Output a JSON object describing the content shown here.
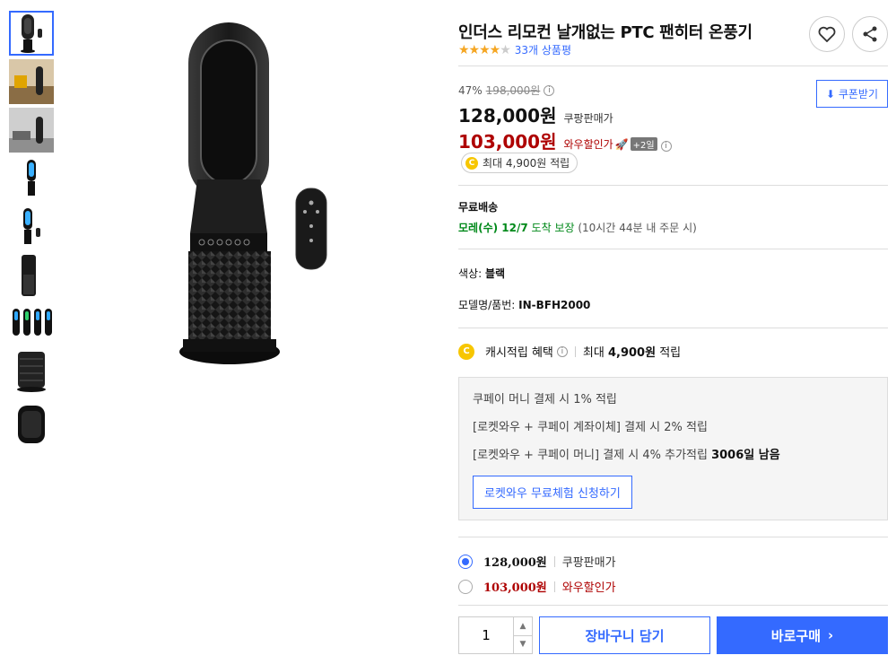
{
  "product": {
    "title": "인더스 리모컨 날개없는 PTC 팬히터 온풍기",
    "rating": 4,
    "review_count_text": "33개 상품평"
  },
  "thumbnails": [
    "thumb-1",
    "thumb-2",
    "thumb-3",
    "thumb-4",
    "thumb-5",
    "thumb-6",
    "thumb-7",
    "thumb-8",
    "thumb-9"
  ],
  "price": {
    "discount_rate": "47%",
    "original_price": "198,000원",
    "sale_price": "128,000원",
    "sale_label": "쿠팡판매가",
    "wow_price": "103,000원",
    "wow_label": "와우할인가",
    "plus_badge": "+2일",
    "coupon_button": "쿠폰받기",
    "cash_pill": "최대 4,900원 적립"
  },
  "shipping": {
    "label": "무료배송",
    "arrive_day": "모레(수) 12/7",
    "arrive_text": "도착 보장",
    "note": "(10시간 44분 내 주문 시)"
  },
  "options": {
    "color_label": "색상:",
    "color_value": "블랙",
    "model_label": "모델명/품번:",
    "model_value": "IN-BFH2000"
  },
  "cash": {
    "label": "캐시적립 혜택",
    "max_prefix": "최대",
    "max_value": "4,900원",
    "max_suffix": "적립"
  },
  "benefits": {
    "line1": "쿠페이 머니 결제 시 1% 적립",
    "line2": "[로켓와우 + 쿠페이 계좌이체] 결제 시 2% 적립",
    "line3_prefix": "[로켓와우 + 쿠페이 머니] 결제 시 4% 추가적립",
    "line3_bold": "3006일 남음",
    "trial_button": "로켓와우 무료체험 신청하기"
  },
  "price_options": [
    {
      "amount": "128,000원",
      "label": "쿠팡판매가",
      "selected": true
    },
    {
      "amount": "103,000원",
      "label": "와우할인가",
      "selected": false
    }
  ],
  "purchase": {
    "quantity": "1",
    "cart_button": "장바구니 담기",
    "buy_button": "바로구매"
  },
  "colors": {
    "accent": "#346aff",
    "wow_red": "#ae0000",
    "green": "#00891a",
    "star": "#f5a623"
  }
}
